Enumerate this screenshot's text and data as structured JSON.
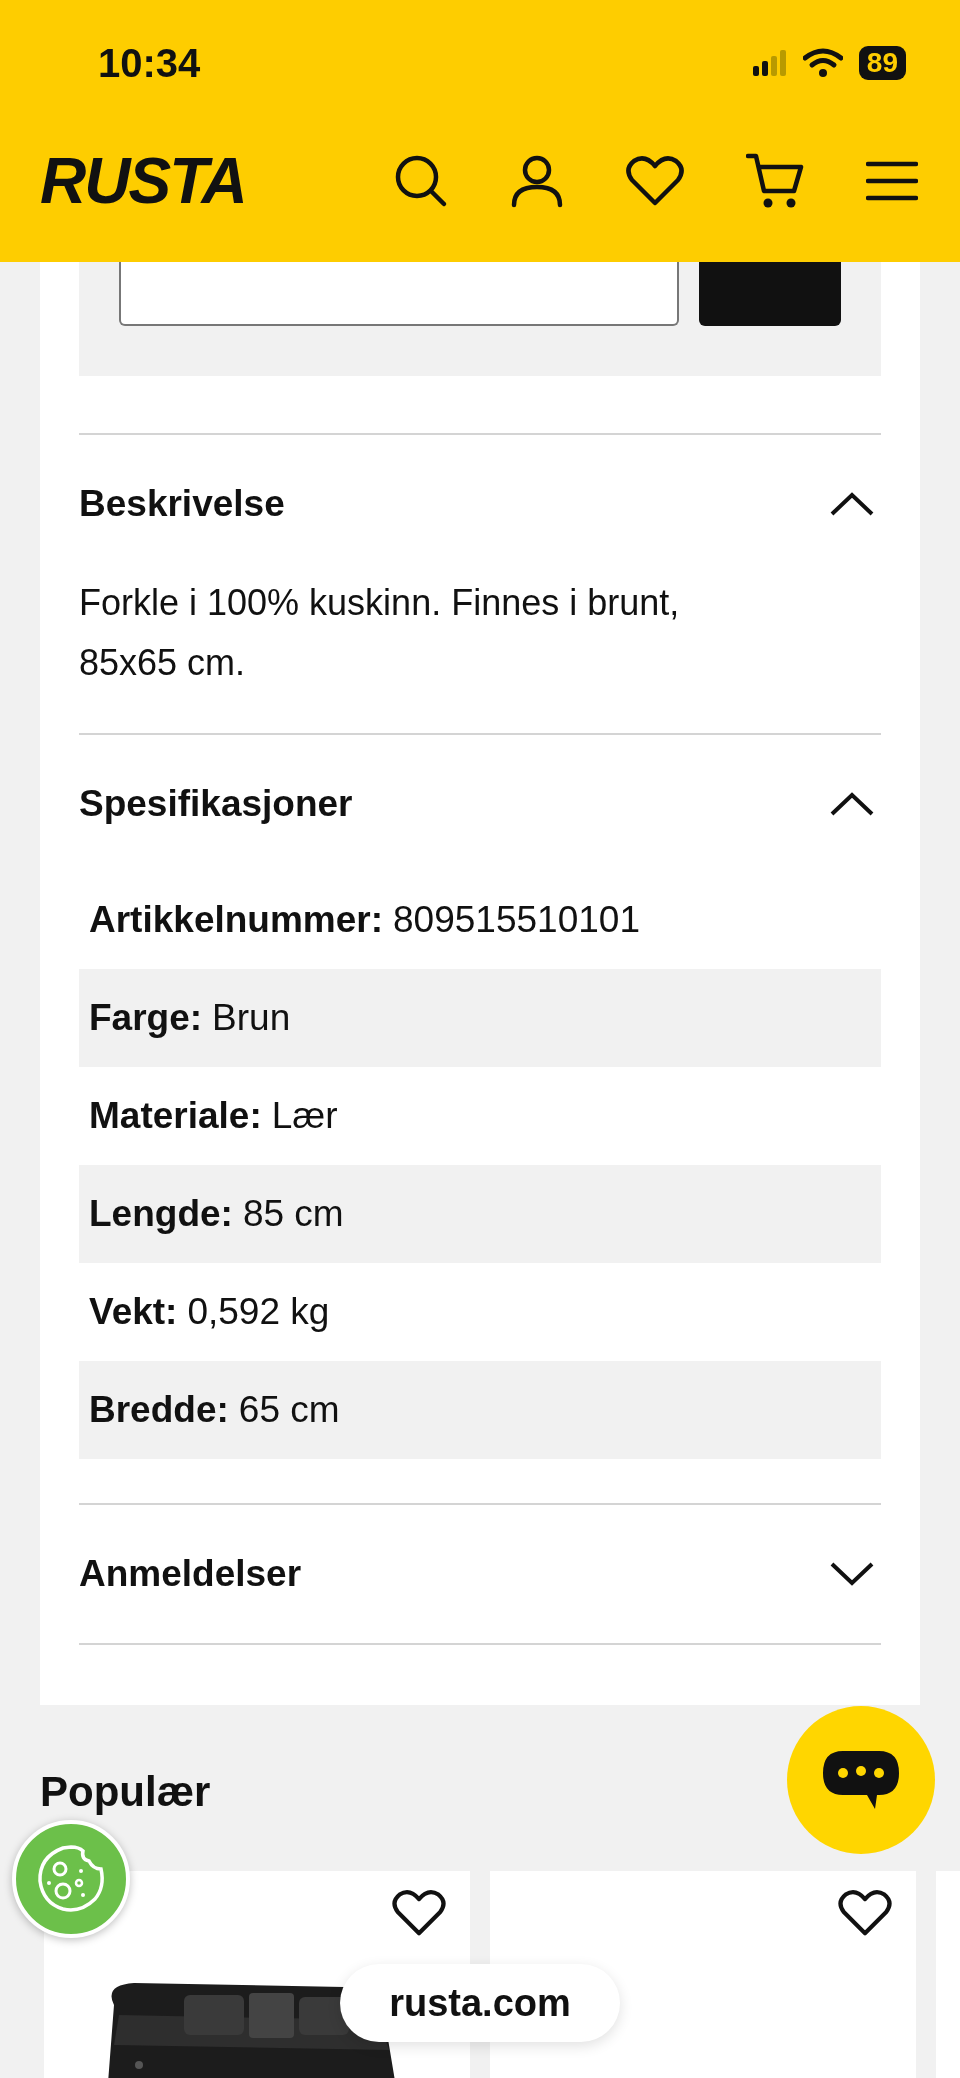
{
  "status_bar": {
    "time": "10:34",
    "battery": "89"
  },
  "header": {
    "logo": "RUSTA"
  },
  "sections": [
    {
      "title": "Beskrivelse",
      "expanded": true,
      "kind": "text",
      "text": "Forkle i 100% kuskinn. Finnes i brunt, 85x65 cm."
    },
    {
      "title": "Spesifikasjoner",
      "expanded": true,
      "kind": "specs",
      "specs": [
        {
          "label": "Artikkelnummer:",
          "value": "809515510101"
        },
        {
          "label": "Farge:",
          "value": "Brun"
        },
        {
          "label": "Materiale:",
          "value": "Lær"
        },
        {
          "label": "Lengde:",
          "value": "85 cm"
        },
        {
          "label": "Vekt:",
          "value": "0,592 kg"
        },
        {
          "label": "Bredde:",
          "value": "65 cm"
        }
      ]
    },
    {
      "title": "Anmeldelser",
      "expanded": false
    }
  ],
  "popular": {
    "title": "Populær",
    "products": [
      {
        "kind": "picture"
      },
      {
        "kind": "blank"
      }
    ]
  },
  "url_bar": {
    "url": "rusta.com"
  }
}
